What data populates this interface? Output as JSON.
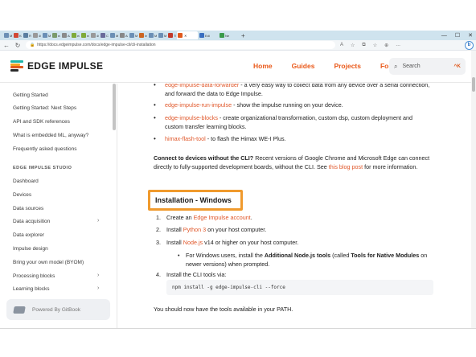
{
  "browser": {
    "tabs": [
      {
        "label": "Mo",
        "color": "#6b8fb5"
      },
      {
        "label": "Ke",
        "color": "#d14836"
      },
      {
        "label": "Re",
        "color": "#5a7ea0"
      },
      {
        "label": "404",
        "color": "#999999"
      },
      {
        "label": "Mo",
        "color": "#6b8fb5"
      },
      {
        "label": "eco",
        "color": "#7a9a6a"
      },
      {
        "label": "Acc",
        "color": "#8a8a8a"
      },
      {
        "label": "edg",
        "color": "#7faa3a"
      },
      {
        "label": "edg",
        "color": "#7faa3a"
      },
      {
        "label": "404",
        "color": "#999999"
      },
      {
        "label": "CO",
        "color": "#6a6a9a"
      },
      {
        "label": "Mo",
        "color": "#6b8fb5"
      },
      {
        "label": "Arc",
        "color": "#888888"
      },
      {
        "label": "Mo",
        "color": "#6b8fb5"
      },
      {
        "label": "Ins",
        "color": "#cc6622"
      },
      {
        "label": "Mo",
        "color": "#6b8fb5"
      },
      {
        "label": "Mo",
        "color": "#6b8fb5"
      },
      {
        "label": "Thi",
        "color": "#c23a2a"
      }
    ],
    "active_tab": {
      "label": "",
      "color": "#e05a1e"
    },
    "after_tabs": [
      {
        "label": "Edi",
        "color": "#3a6fc0"
      },
      {
        "label": "Ne",
        "color": "#3a9a4a"
      }
    ],
    "new_tab": "+",
    "window_controls": [
      "—",
      "☐",
      "✕"
    ],
    "url": "https://docs.edgeimpulse.com/docs/edge-impulse-cli/cli-installation",
    "addr_icons": [
      "A",
      "☆",
      "⧉",
      "☆",
      "⊕",
      "…"
    ]
  },
  "site": {
    "logo_text": "EDGE IMPULSE",
    "logo_colors": [
      "#1db5a8",
      "#f5a623",
      "#e05a1e",
      "#2a2a2a"
    ],
    "nav": [
      "Home",
      "Guides",
      "Projects",
      "Forum"
    ],
    "search_placeholder": "Search",
    "search_shortcut": "^K"
  },
  "sidebar": {
    "items_top": [
      "Getting Started",
      "Getting Started: Next Steps",
      "API and SDK references",
      "What is embedded ML, anyway?",
      "Frequently asked questions"
    ],
    "section_title": "EDGE IMPULSE STUDIO",
    "studio_items": [
      {
        "label": "Dashboard",
        "chevron": ""
      },
      {
        "label": "Devices",
        "chevron": ""
      },
      {
        "label": "Data sources",
        "chevron": ""
      },
      {
        "label": "Data acquisition",
        "chevron": "›"
      },
      {
        "label": "Data explorer",
        "chevron": ""
      },
      {
        "label": "Impulse design",
        "chevron": ""
      },
      {
        "label": "Bring your own model (BYOM)",
        "chevron": ""
      },
      {
        "label": "Processing blocks",
        "chevron": "›"
      },
      {
        "label": "Learning blocks",
        "chevron": "›"
      }
    ],
    "gitbook_label": "Powered By GitBook"
  },
  "content": {
    "bullets": [
      {
        "link": "edge-impulse-data-forwarder",
        "text": " - a very easy way to collect data from any device over a serial connection, and forward the data to Edge Impulse."
      },
      {
        "link": "edge-impulse-run-impulse",
        "text": " - show the impulse running on your device."
      },
      {
        "link": "edge-impulse-blocks",
        "text": " - create organizational transformation, custom dsp, custom deployment and custom transfer learning blocks."
      },
      {
        "link": "himax-flash-tool",
        "text": " - to flash the Himax WE-I Plus."
      }
    ],
    "connect_para": {
      "bold": "Connect to devices without the CLI?",
      "text": " Recent versions of Google Chrome and Microsoft Edge can connect directly to fully-supported development boards, without the CLI. See ",
      "link": "this blog post",
      "tail": " for more information."
    },
    "heading": "Installation - Windows",
    "steps": [
      {
        "num": "1.",
        "pre": "Create an ",
        "link": "Edge Impulse account",
        "post": "."
      },
      {
        "num": "2.",
        "pre": "Install ",
        "link": "Python 3",
        "post": " on your host computer."
      },
      {
        "num": "3.",
        "pre": "Install ",
        "link": "Node.js",
        "post": " v14 or higher on your host computer."
      },
      {
        "num": "4.",
        "pre": "Install the CLI tools via:",
        "link": "",
        "post": ""
      }
    ],
    "sub_bullet": {
      "pre": "For Windows users, install the ",
      "bold1": "Additional Node.js tools",
      "mid": " (called ",
      "bold2": "Tools for Native Modules",
      "post": " on newer versions) when prompted."
    },
    "code": "npm install -g edge-impulse-cli --force",
    "final_para": "You should now have the tools available in your PATH."
  }
}
